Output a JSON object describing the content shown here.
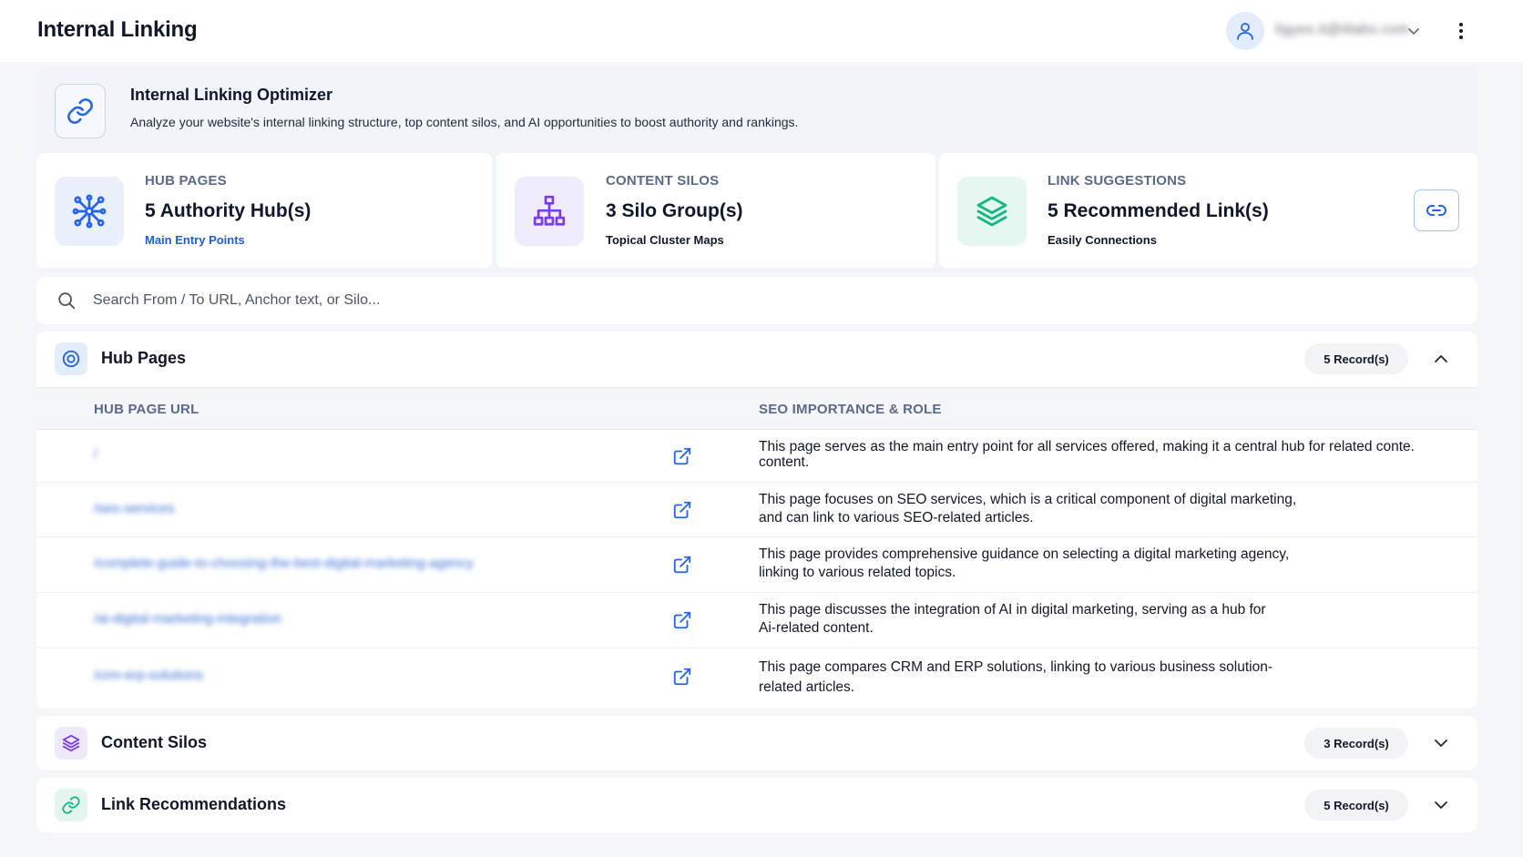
{
  "header": {
    "title": "Internal Linking",
    "user_name": "ligyes.it@itlabs.com"
  },
  "optimizer": {
    "title": "Internal Linking Optimizer",
    "description": "Analyze your website's internal linking structure, top content silos, and AI opportunities to boost authority and rankings."
  },
  "stats": [
    {
      "label": "HUB PAGES",
      "value": "5 Authority Hub(s)",
      "sub": "Main Entry Points",
      "icon": "network-hub-icon",
      "color": "#2563eb"
    },
    {
      "label": "CONTENT SILOS",
      "value": "3 Silo Group(s)",
      "sub": "Topical Cluster Maps",
      "icon": "sitemap-icon",
      "color": "#7c3aed"
    },
    {
      "label": "LINK SUGGESTIONS",
      "value": "5 Recommended Link(s)",
      "sub": "Easily Connections",
      "icon": "layers-icon",
      "color": "#10b981"
    }
  ],
  "search": {
    "placeholder": "Search From / To URL, Anchor text, or Silo..."
  },
  "hub_pages": {
    "title": "Hub Pages",
    "badge": "5 Record(s)",
    "columns": [
      "HUB PAGE URL",
      "SEO IMPORTANCE & ROLE"
    ],
    "rows": [
      {
        "url": "/",
        "role": "This page serves as the main entry point for all services offered, making it a central hub for related conte.\ncontent."
      },
      {
        "url": "/seo-services",
        "role": "This page focuses on SEO services, which is a critical component of digital marketing,\nand can link to various SEO-related articles."
      },
      {
        "url": "/complete-guide-to-choosing-the-best-digital-marketing-agency",
        "role": "This page provides comprehensive guidance on selecting a digital marketing agency,\nlinking to various related topics."
      },
      {
        "url": "/ai-digital-marketing-integration",
        "role": "This page discusses the integration of AI in digital marketing, serving as a hub for\nAi-related content."
      },
      {
        "url": "/crm-erp-solutions",
        "role": "This page compares CRM and ERP solutions, linking to various business solution-\nrelated articles."
      }
    ]
  },
  "content_silos": {
    "title": "Content Silos",
    "badge": "3 Record(s)"
  },
  "link_recommendations": {
    "title": "Link Recommendations",
    "badge": "5 Record(s)"
  },
  "colors": {
    "accent": "#2563eb",
    "purple": "#7c3aed",
    "green": "#10b981"
  }
}
